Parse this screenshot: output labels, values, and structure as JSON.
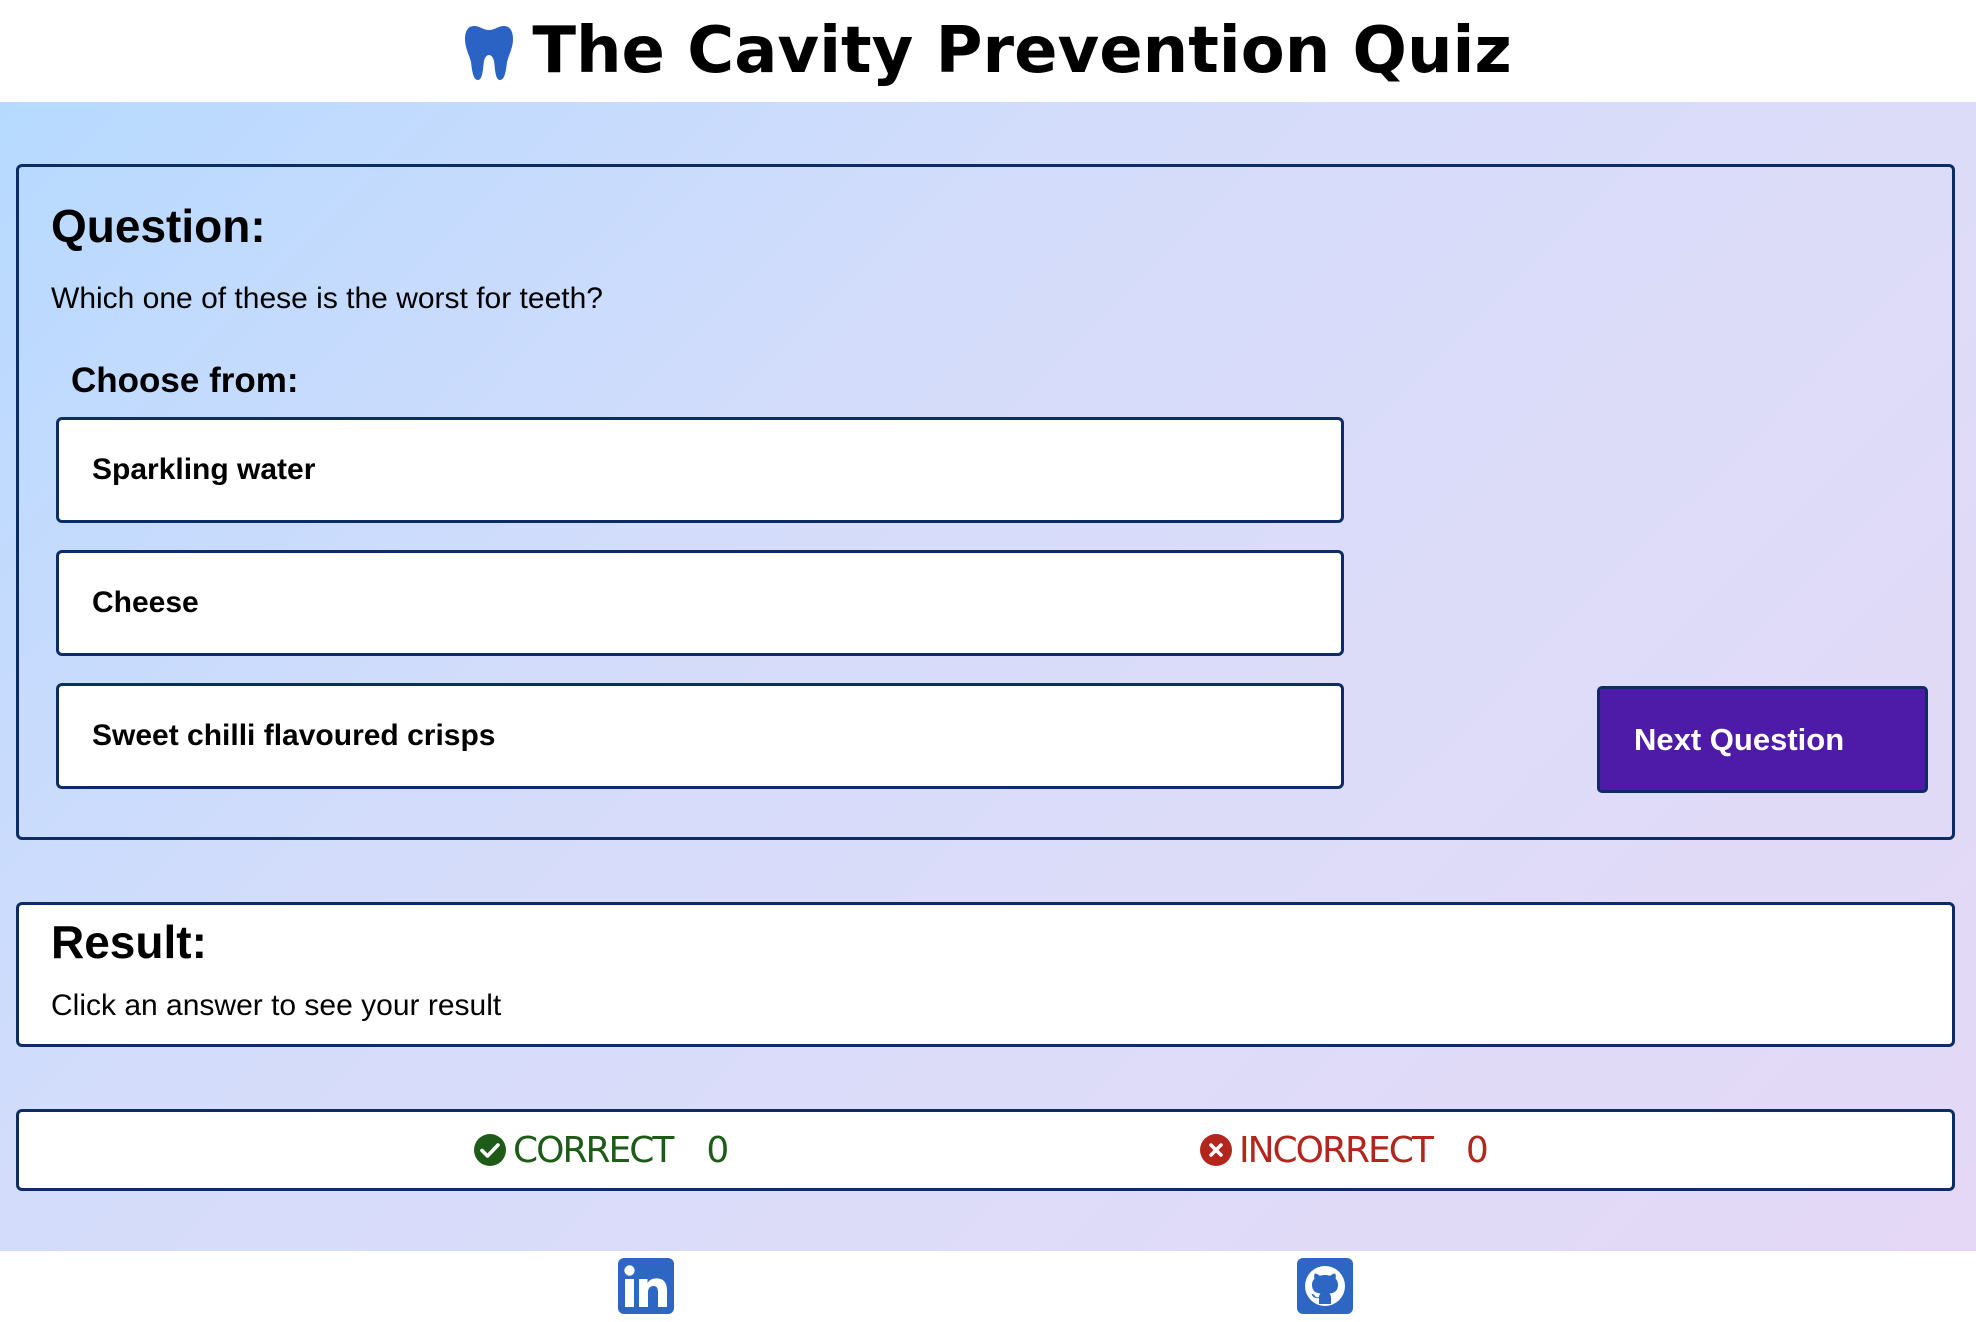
{
  "header": {
    "title": "The Cavity Prevention Quiz",
    "logo_icon": "tooth-icon",
    "logo_color": "#2b63c4"
  },
  "question": {
    "heading": "Question:",
    "text": "Which one of these is the worst for teeth?",
    "choose_label": "Choose from:",
    "answers": [
      "Sparkling water",
      "Cheese",
      "Sweet chilli flavoured crisps"
    ],
    "next_label": "Next Question"
  },
  "result": {
    "heading": "Result:",
    "text": "Click an answer to see your result"
  },
  "score": {
    "correct_label": "CORRECT",
    "correct_count": "0",
    "incorrect_label": "INCORRECT",
    "incorrect_count": "0"
  },
  "footer": {
    "links": [
      {
        "icon": "linkedin-icon",
        "color": "#2d66c3"
      },
      {
        "icon": "github-icon",
        "color": "#2d66c3"
      }
    ]
  },
  "colors": {
    "accent": "#4e1ba8",
    "border": "#0d2c63",
    "correct": "#1e5b18",
    "incorrect": "#b3261e"
  }
}
